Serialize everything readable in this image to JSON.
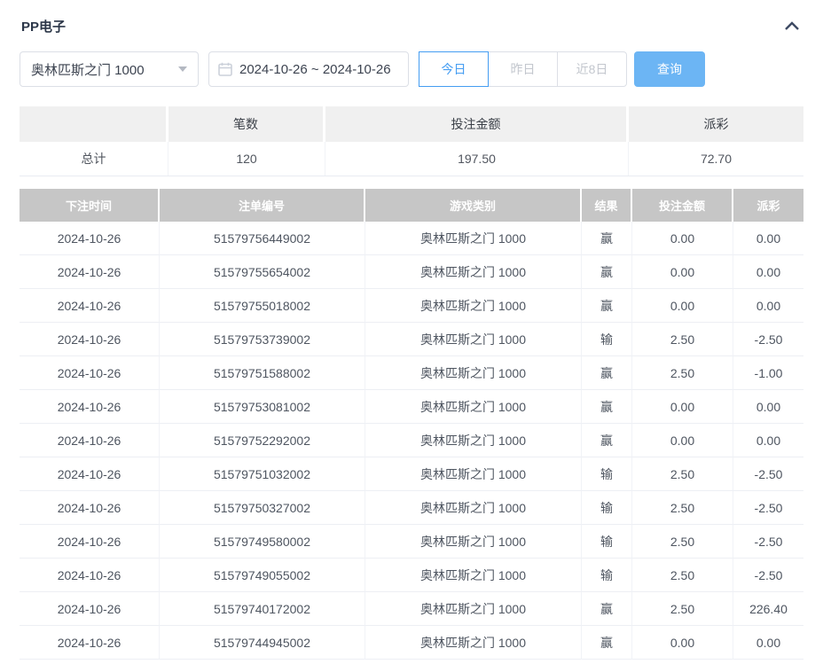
{
  "panel": {
    "title": "PP电子",
    "collapse_icon": "chevron-up"
  },
  "filters": {
    "game_select": {
      "value": "奥林匹斯之门 1000",
      "icon": "caret-down-icon"
    },
    "date_range": {
      "value": "2024-10-26 ~ 2024-10-26",
      "icon": "calendar-icon"
    },
    "quick_buttons": [
      {
        "label": "今日",
        "active": true
      },
      {
        "label": "昨日",
        "active": false
      },
      {
        "label": "近8日",
        "active": false
      }
    ],
    "search_button": "查询"
  },
  "summary": {
    "columns": [
      "",
      "笔数",
      "投注金额",
      "派彩"
    ],
    "row": {
      "label": "总计",
      "count": "120",
      "bet_amount": "197.50",
      "payout": "72.70"
    }
  },
  "records": {
    "columns": [
      "下注时间",
      "注单编号",
      "游戏类别",
      "结果",
      "投注金额",
      "派彩"
    ],
    "rows": [
      {
        "date": "2024-10-26",
        "order_no": "51579756449002",
        "game": "奥林匹斯之门 1000",
        "result": "赢",
        "bet": "0.00",
        "payout": "0.00"
      },
      {
        "date": "2024-10-26",
        "order_no": "51579755654002",
        "game": "奥林匹斯之门 1000",
        "result": "赢",
        "bet": "0.00",
        "payout": "0.00"
      },
      {
        "date": "2024-10-26",
        "order_no": "51579755018002",
        "game": "奥林匹斯之门 1000",
        "result": "赢",
        "bet": "0.00",
        "payout": "0.00"
      },
      {
        "date": "2024-10-26",
        "order_no": "51579753739002",
        "game": "奥林匹斯之门 1000",
        "result": "输",
        "bet": "2.50",
        "payout": "-2.50"
      },
      {
        "date": "2024-10-26",
        "order_no": "51579751588002",
        "game": "奥林匹斯之门 1000",
        "result": "赢",
        "bet": "2.50",
        "payout": "-1.00"
      },
      {
        "date": "2024-10-26",
        "order_no": "51579753081002",
        "game": "奥林匹斯之门 1000",
        "result": "赢",
        "bet": "0.00",
        "payout": "0.00"
      },
      {
        "date": "2024-10-26",
        "order_no": "51579752292002",
        "game": "奥林匹斯之门 1000",
        "result": "赢",
        "bet": "0.00",
        "payout": "0.00"
      },
      {
        "date": "2024-10-26",
        "order_no": "51579751032002",
        "game": "奥林匹斯之门 1000",
        "result": "输",
        "bet": "2.50",
        "payout": "-2.50"
      },
      {
        "date": "2024-10-26",
        "order_no": "51579750327002",
        "game": "奥林匹斯之门 1000",
        "result": "输",
        "bet": "2.50",
        "payout": "-2.50"
      },
      {
        "date": "2024-10-26",
        "order_no": "51579749580002",
        "game": "奥林匹斯之门 1000",
        "result": "输",
        "bet": "2.50",
        "payout": "-2.50"
      },
      {
        "date": "2024-10-26",
        "order_no": "51579749055002",
        "game": "奥林匹斯之门 1000",
        "result": "输",
        "bet": "2.50",
        "payout": "-2.50"
      },
      {
        "date": "2024-10-26",
        "order_no": "51579740172002",
        "game": "奥林匹斯之门 1000",
        "result": "赢",
        "bet": "2.50",
        "payout": "226.40"
      },
      {
        "date": "2024-10-26",
        "order_no": "51579744945002",
        "game": "奥林匹斯之门 1000",
        "result": "赢",
        "bet": "0.00",
        "payout": "0.00"
      }
    ]
  },
  "colors": {
    "primary": "#459df2",
    "search_fill": "#6cb5f4",
    "danger": "#f56c6c",
    "table_header_bg": "#c6c6c6"
  }
}
